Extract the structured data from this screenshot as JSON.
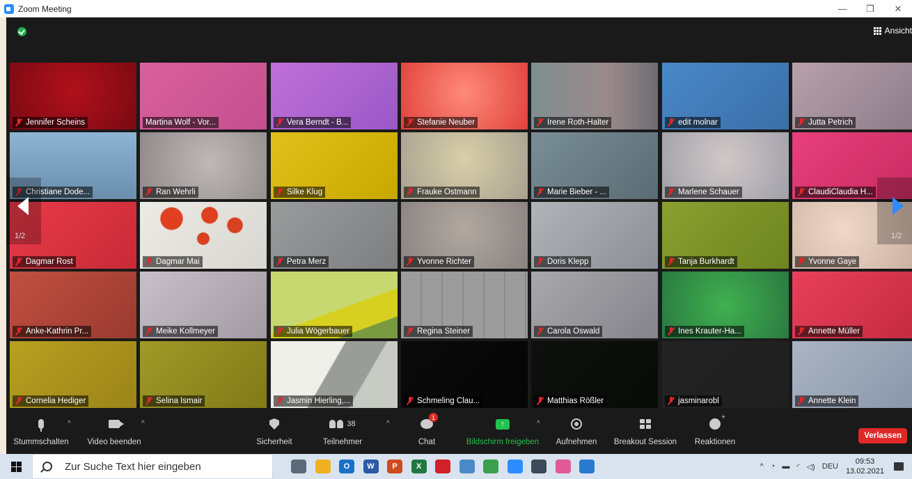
{
  "window": {
    "title": "Zoom Meeting",
    "minimize": "—",
    "restore": "❐",
    "close": "✕"
  },
  "topbar": {
    "view_label": "Ansicht"
  },
  "participants": [
    {
      "name": "Jennifer Scheins",
      "bg": "radial-gradient(circle at 50% 40%, #b0101c, #7a0a12)"
    },
    {
      "name": "Martina Wolf - Vor...",
      "bg": "linear-gradient(135deg, #d9609a, #c45090)",
      "active": true
    },
    {
      "name": "Vera Berndt - B...",
      "bg": "linear-gradient(135deg, #c070d8, #9a58c6)"
    },
    {
      "name": "Stefanie Neuber",
      "bg": "radial-gradient(circle at 50% 45%, #ff8a7a, #e0423c)"
    },
    {
      "name": "Irene Roth-Halter",
      "bg": "linear-gradient(90deg, #7e8e90, #9b8a8c 60%, #6e6c70)"
    },
    {
      "name": "edit molnar",
      "bg": "linear-gradient(135deg, #4a88c8, #3a6fa8)"
    },
    {
      "name": "Jutta Petrich",
      "bg": "linear-gradient(135deg, #b8a0aa, #8a7c88)"
    },
    {
      "name": "Christiane Dode...",
      "bg": "linear-gradient(180deg, #8eb4d4, #6a8eac)"
    },
    {
      "name": "Ran Wehrli",
      "bg": "radial-gradient(circle at 55% 45%, #c0b8b8, #8e8888)"
    },
    {
      "name": "Silke Klug",
      "bg": "linear-gradient(135deg, #e0c01a, #c8a800)"
    },
    {
      "name": "Frauke Ostmann",
      "bg": "radial-gradient(circle at 50% 40%, #d8d0a8, #a8a090)"
    },
    {
      "name": "Marie Bieber - ...",
      "bg": "linear-gradient(135deg, #7a8e96, #5a6c74)"
    },
    {
      "name": "Marlene Schauer",
      "bg": "radial-gradient(circle at 50% 40%, #d0c8c8, #a0a0a8)"
    },
    {
      "name": "ClaudiClaudia H...",
      "bg": "linear-gradient(135deg, #e8407a, #c82a60)"
    },
    {
      "name": "Dagmar Rost",
      "bg": "linear-gradient(135deg, #e83a48, #c82a38)"
    },
    {
      "name": "Dagmar Mai",
      "bg": "radial-gradient(circle at 25% 25%, #e04020 0 10%, transparent 11%), radial-gradient(circle at 55% 20%, #e04020 0 9%, transparent 10%), radial-gradient(circle at 50% 55%, #d84020 0 8%, transparent 9%), radial-gradient(circle at 75% 35%, #d84020 0 7%, transparent 8%), linear-gradient(135deg, #ecebe6, #d8d6d0)"
    },
    {
      "name": "Petra Merz",
      "bg": "linear-gradient(135deg, #9a9c9c, #7c7e80)"
    },
    {
      "name": "Yvonne Richter",
      "bg": "radial-gradient(circle at 50% 40%, #b0a8a0, #8a8280)"
    },
    {
      "name": "Doris Klepp",
      "bg": "linear-gradient(135deg, #b0b4b8, #8c9094)"
    },
    {
      "name": "Tanja Burkhardt",
      "bg": "linear-gradient(135deg, #8aa030, #6e8420)"
    },
    {
      "name": "Yvonne Gaye",
      "bg": "radial-gradient(circle at 40% 40%, #f0d8c8, #c8b0a0)"
    },
    {
      "name": "Anke-Kathrin Pr...",
      "bg": "linear-gradient(135deg, #c05040, #9a3a30)"
    },
    {
      "name": "Meike Kollmeyer",
      "bg": "linear-gradient(135deg, #c8c0c8, #a09aa2)"
    },
    {
      "name": "Julia Wögerbauer",
      "bg": "linear-gradient(160deg, #c8d870 0 55%, #d8d020 56% 80%, #7a9a40 81%)"
    },
    {
      "name": "Regina Steiner",
      "bg": "repeating-linear-gradient(90deg, #9c9c9c 0 28px, #8a8a8a 28px 30px), linear-gradient(#999, #888)"
    },
    {
      "name": "Carola Oswald",
      "bg": "linear-gradient(135deg, #a8a8ac, #84848a)"
    },
    {
      "name": "Ines Krauter-Ha...",
      "bg": "radial-gradient(circle at 50% 50%, #40b050, #2a7a40)"
    },
    {
      "name": "Annette Müller",
      "bg": "linear-gradient(135deg, #e8405a, #c42a40)"
    },
    {
      "name": "Cornelia Hediger",
      "bg": "linear-gradient(135deg, #b8a020, #9a8418)"
    },
    {
      "name": "Selina Ismair",
      "bg": "linear-gradient(135deg, #a09a28, #807a18)"
    },
    {
      "name": "Jasmin Hierling,...",
      "bg": "linear-gradient(120deg, #f0f0ea 0 45%, #9a9c98 46% 70%, #c8cac4 71%)"
    },
    {
      "name": "Schmeling Clau...",
      "bg": "linear-gradient(135deg, #0a0a0a, #050505)"
    },
    {
      "name": "Matthias Rößler",
      "bg": "linear-gradient(135deg, #0e100e, #080a08)"
    },
    {
      "name": "jasminarobl",
      "bg": "linear-gradient(135deg, #232323, #1f1f1f)"
    },
    {
      "name": "Annette Klein",
      "bg": "linear-gradient(135deg, #aab4c4, #8a96a8)"
    }
  ],
  "pager": {
    "left": "1/2",
    "right": "1/2"
  },
  "controls": {
    "mute": "Stummschalten",
    "video": "Video beenden",
    "security": "Sicherheit",
    "participants": "Teilnehmer",
    "participants_count": "38",
    "chat": "Chat",
    "chat_badge": "1",
    "share": "Bildschirm freigeben",
    "record": "Aufnehmen",
    "breakout": "Breakout Session",
    "reactions": "Reaktionen",
    "leave": "Verlassen"
  },
  "taskbar": {
    "search_placeholder": "Zur Suche Text hier eingeben",
    "lang": "DEU",
    "time": "09:53",
    "date": "13.02.2021",
    "apps": [
      {
        "icon": "task-view-icon",
        "color": "#5a6a7a",
        "label": ""
      },
      {
        "icon": "file-explorer-icon",
        "color": "#f0b020",
        "label": ""
      },
      {
        "icon": "outlook-icon",
        "color": "#1a70c8",
        "label": "O"
      },
      {
        "icon": "word-icon",
        "color": "#2a5aa8",
        "label": "W"
      },
      {
        "icon": "powerpoint-icon",
        "color": "#d04a20",
        "label": "P"
      },
      {
        "icon": "excel-icon",
        "color": "#1f7a40",
        "label": "X"
      },
      {
        "icon": "acrobat-icon",
        "color": "#d0202a",
        "label": ""
      },
      {
        "icon": "app-icon",
        "color": "#4a8ac8",
        "label": ""
      },
      {
        "icon": "chrome-icon",
        "color": "#3aa050",
        "label": ""
      },
      {
        "icon": "zoom-icon",
        "color": "#2d8cff",
        "label": ""
      },
      {
        "icon": "calculator-icon",
        "color": "#3a4a5a",
        "label": ""
      },
      {
        "icon": "paint-icon",
        "color": "#e05a9a",
        "label": ""
      },
      {
        "icon": "store-icon",
        "color": "#2a7ad0",
        "label": ""
      }
    ]
  }
}
